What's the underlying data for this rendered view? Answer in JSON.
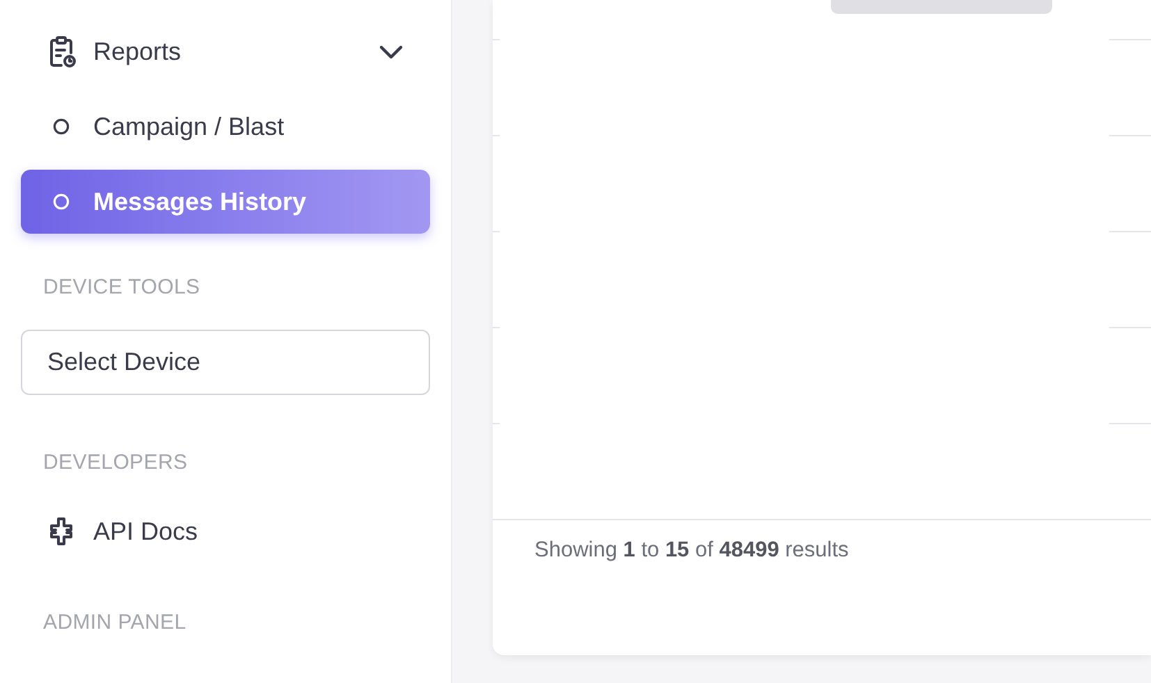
{
  "sidebar": {
    "items": [
      {
        "kind": "group",
        "label": "Reports",
        "expanded": true
      },
      {
        "kind": "sub",
        "label": "Campaign / Blast",
        "selected": false
      },
      {
        "kind": "sub",
        "label": "Messages History",
        "selected": true
      },
      {
        "kind": "section",
        "label": "DEVICE TOOLS"
      },
      {
        "kind": "select",
        "value": "Select Device"
      },
      {
        "kind": "section",
        "label": "DEVELOPERS"
      },
      {
        "kind": "link",
        "label": "API Docs"
      },
      {
        "kind": "section",
        "label": "ADMIN PANEL"
      }
    ]
  },
  "table": {
    "summary": "Showing **1** to **15** of **48499** results"
  }
}
